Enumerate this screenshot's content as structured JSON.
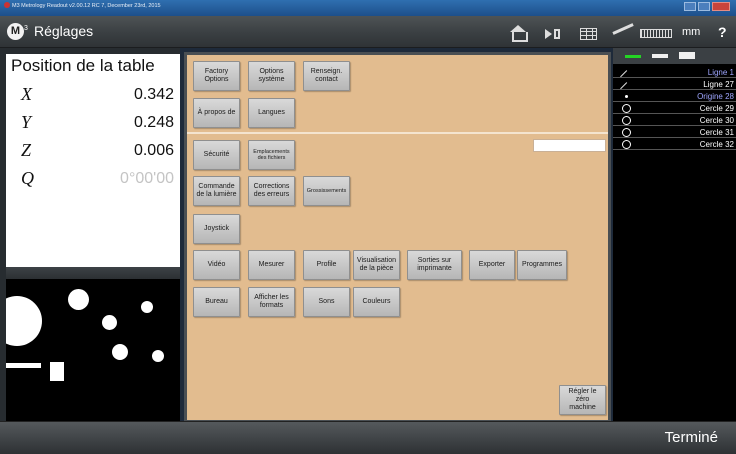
{
  "window": {
    "title": "M3 Metrology Readout  v2.00.12 RC 7, December 23rd, 2015"
  },
  "appbar": {
    "logo": "M",
    "logo_sup": "3",
    "title": "Réglages",
    "units": "mm",
    "help": "?"
  },
  "dro": {
    "title": "Position de la table",
    "axes": [
      {
        "axis": "X",
        "value": "0.342"
      },
      {
        "axis": "Y",
        "value": "0.248"
      },
      {
        "axis": "Z",
        "value": "0.006"
      },
      {
        "axis": "Q",
        "value": "0°00'00"
      }
    ]
  },
  "buttons": {
    "factory": "Factory Options",
    "options_systeme": "Options système",
    "renseign": "Renseign. contact",
    "a_propos": "À propos de",
    "langues": "Langues",
    "securite": "Sécurité",
    "emplacements": "Emplacements des fichiers",
    "commande_lumiere": "Commande de la lumière",
    "corrections": "Corrections des erreurs",
    "grossissements": "Grossissements",
    "joystick": "Joystick",
    "video": "Vidéo",
    "mesurer": "Mesurer",
    "profile": "Profile",
    "visualisation": "Visualisation de la pièce",
    "sorties": "Sorties sur imprimante",
    "exporter": "Exporter",
    "programmes": "Programmes",
    "bureau": "Bureau",
    "afficher_formats": "Afficher les formats",
    "sons": "Sons",
    "couleurs": "Couleurs",
    "regler_zero": "Régler le zéro machine"
  },
  "features": [
    {
      "type": "line",
      "label": "Ligne 1",
      "color": "#9fa6ff"
    },
    {
      "type": "line",
      "label": "Ligne 27",
      "color": "#ffffff"
    },
    {
      "type": "point",
      "label": "Origine 28",
      "color": "#9fa6ff"
    },
    {
      "type": "circle",
      "label": "Cercle 29",
      "color": "#ffffff"
    },
    {
      "type": "circle",
      "label": "Cercle 30",
      "color": "#ffffff"
    },
    {
      "type": "circle",
      "label": "Cercle 31",
      "color": "#ffffff"
    },
    {
      "type": "circle",
      "label": "Cercle 32",
      "color": "#ffffff"
    }
  ],
  "bottombar": {
    "done": "Terminé"
  },
  "colors": {
    "panel": "#e2bc8f",
    "accent_green": "#24d424",
    "selected_feature": "#9fa6ff"
  }
}
